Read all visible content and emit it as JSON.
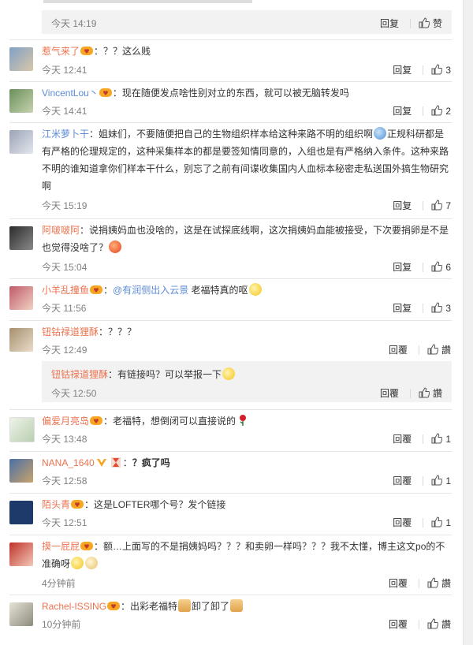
{
  "colors": {
    "username": "#eb7350",
    "link": "#5d8bd6",
    "time": "#808080",
    "subreply_bg": "#f2f2f2"
  },
  "top": {
    "time": "今天 14:19",
    "reply": "回复",
    "like": "赞"
  },
  "comments": [
    {
      "user": "惹气来了",
      "text": "：？？这么贱",
      "time": "今天 12:41",
      "reply": "回复",
      "likes": "3"
    },
    {
      "user": "VincentLou丶",
      "text": "：现在随便发点啥性别对立的东西，就可以被无脑转发吗",
      "time": "今天 14:41",
      "reply": "回复",
      "likes": "2"
    },
    {
      "user": "江米萝卜干",
      "text1": "：姐妹们，不要随便把自己的生物组织样本给这种来路不明的组织啊",
      "text2": "正规科研都是有严格的伦理规定的，这种采集样本的都是要签知情同意的，入组也是有严格纳入条件。这种来路不明的谁知道拿你们样本干什么，别忘了之前有间谍收集国内人血标本秘密走私送国外搞生物研究啊",
      "time": "今天 15:19",
      "reply": "回复",
      "likes": "7"
    },
    {
      "user": "阿啵啵阿",
      "text": "：说捐姨妈血也没啥的，这是在试探底线啊，这次捐姨妈血能被接受，下次要捐卵是不是也觉得没啥了？",
      "time": "今天 15:04",
      "reply": "回复",
      "likes": "6"
    },
    {
      "user": "小羊乱撞鱼",
      "text_pre": "：",
      "mention": "@有润侧出入云景",
      "text": " 老福特真的呕",
      "time": "今天 11:56",
      "reply": "回复",
      "likes": "3"
    },
    {
      "user": "钮钴禄道狸酥",
      "text": "：？？？",
      "time": "今天 12:49",
      "reply": "回覆",
      "likes": "讚",
      "sub": {
        "user": "钮钴禄道狸酥",
        "text": "：有链接吗？可以举报一下",
        "time": "今天 12:50",
        "reply": "回覆",
        "likes": "讚"
      }
    },
    {
      "user": "偏爱月亮岛",
      "text": "：老福特，想倒闭可以直接说的",
      "time": "今天 13:48",
      "reply": "回覆",
      "likes": "1"
    },
    {
      "user": "NANA_1640",
      "text": "：",
      "text_bold": "？疯了吗",
      "time": "今天 12:58",
      "reply": "回覆",
      "likes": "1"
    },
    {
      "user": "陌头青",
      "text": "：这是LOFTER哪个号？发个链接",
      "time": "今天 12:51",
      "reply": "回覆",
      "likes": "1"
    },
    {
      "user": "摸一屁屁",
      "text": "：额…上面写的不是捐姨妈吗？？？和卖卵一样吗？？？我不太懂，博主这文po的不准确呀",
      "time": "4分钟前",
      "reply": "回覆",
      "likes": "讚"
    },
    {
      "user": "Rachel-ISSING",
      "text": "：出彩老福特",
      "text2": "卸了卸了",
      "time": "10分钟前",
      "reply": "回覆",
      "likes": "讚"
    }
  ]
}
